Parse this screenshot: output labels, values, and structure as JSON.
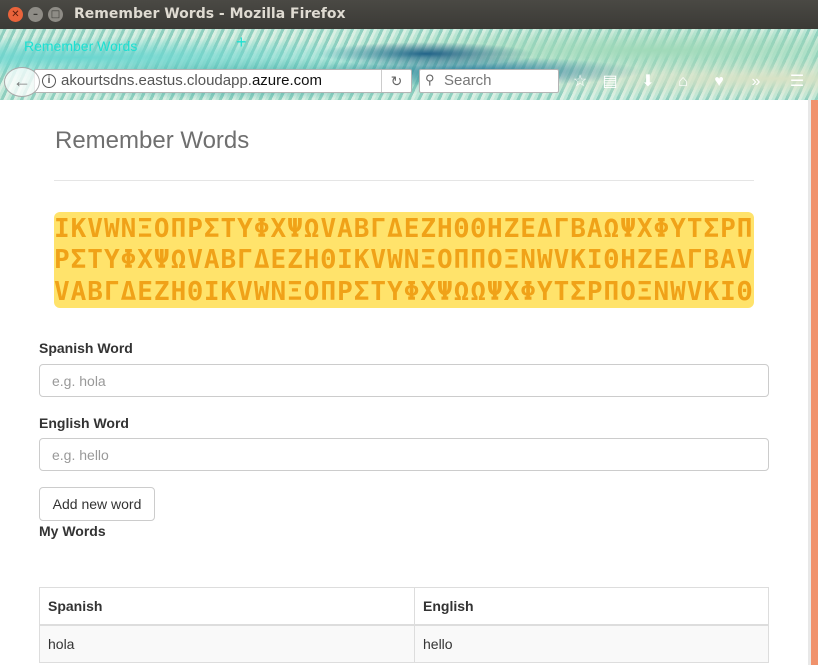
{
  "window": {
    "title": "Remember Words - Mozilla Firefox"
  },
  "browser": {
    "tab_title": "Remember Words",
    "url_prefix": "akourtsdns.eastus.cloudapp.",
    "url_domain": "azure.com",
    "search_placeholder": "Search"
  },
  "app": {
    "title": "Remember Words",
    "banner_rows": [
      "IKVWNΞOΠPΣTYΦXΨΩVABΓΔEZHΘΘHZEΔΓBAΩΨXΦYTΣPΠO",
      "PΣTYΦXΨΩVABΓΔEZHΘIKVWNΞOΠΠOΞNWVKIΘHZEΔΓBAVΩΨ",
      "VABΓΔEZHΘIKVWNΞOΠPΣTYΦXΨΩΩΨXΦYTΣPΠOΞNWVKIΘHI"
    ],
    "spanish_label": "Spanish Word",
    "spanish_placeholder": "e.g. hola",
    "english_label": "English Word",
    "english_placeholder": "e.g. hello",
    "add_button": "Add new word",
    "my_words_heading": "My Words",
    "table": {
      "headers": [
        "Spanish",
        "English"
      ],
      "rows": [
        [
          "hola",
          "hello"
        ]
      ]
    }
  },
  "colors": {
    "banner_bg": "#ffe36b",
    "banner_text": "#f0a218",
    "scroll_accent": "#f0926c"
  }
}
